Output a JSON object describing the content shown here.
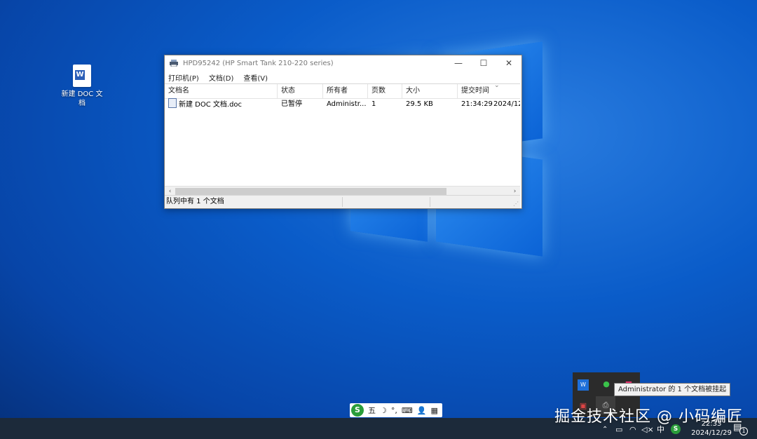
{
  "desktop": {
    "icon_label": "新建 DOC 文档",
    "icon_glyph": "W"
  },
  "window": {
    "title": "HPD95242 (HP Smart Tank 210-220 series)",
    "buttons": {
      "minimize": "—",
      "maximize": "☐",
      "close": "✕"
    },
    "menus": [
      "打印机(P)",
      "文档(D)",
      "查看(V)"
    ],
    "columns": [
      "文档名",
      "状态",
      "所有者",
      "页数",
      "大小",
      "提交时间"
    ],
    "rows": [
      {
        "name": "新建 DOC 文档.doc",
        "status": "已暂停",
        "owner": "Administr...",
        "pages": "1",
        "size": "29.5 KB",
        "time": "21:34:29",
        "date": "2024/12..."
      }
    ],
    "status_text": "队列中有 1 个文档"
  },
  "ime": {
    "logo": "S",
    "mode": "五",
    "icons": [
      "☽",
      "°,",
      "⌨",
      "👤",
      "▦"
    ]
  },
  "tray_popup": {
    "tooltip": "Administrator 的 1 个文档被挂起"
  },
  "taskbar": {
    "input_lang": "中",
    "time": "22:33",
    "date": "2024/12/29",
    "notification_count": "1"
  },
  "watermark": "掘金技术社区 @ 小码编匠"
}
